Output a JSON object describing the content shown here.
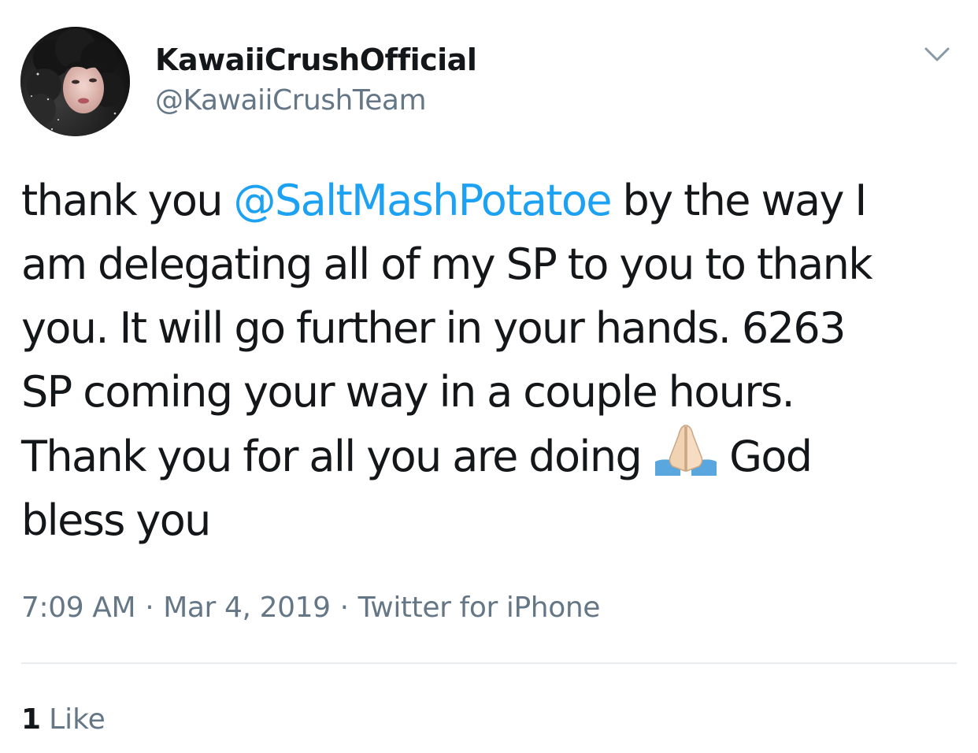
{
  "colors": {
    "text": "#14171a",
    "secondary": "#657786",
    "link": "#1da1f2",
    "divider": "#e6ecf0",
    "background": "#ffffff"
  },
  "tweet": {
    "author": {
      "display_name": "KawaiiCrushOfficial",
      "handle": "@KawaiiCrushTeam",
      "avatar_icon": "user-avatar-photo"
    },
    "menu_icon": "chevron-down-icon",
    "body": {
      "line1_before": "thank you ",
      "mention": "@SaltMashPotatoe",
      "line1_after": " by the way I",
      "line2": "am delegating all of my SP to you to thank",
      "line3": "you. It will go further in your hands. 6263",
      "line4": "SP coming your way in a couple hours.",
      "line5_before": "Thank you for all you are doing",
      "emoji": "folded-hands-emoji",
      "line5_after": "God",
      "line6": "bless you"
    },
    "meta": {
      "time": "7:09 AM",
      "separator": "·",
      "date": "Mar 4, 2019",
      "source": "Twitter for iPhone"
    },
    "stats": {
      "likes_count": "1",
      "likes_label": "Like"
    }
  }
}
